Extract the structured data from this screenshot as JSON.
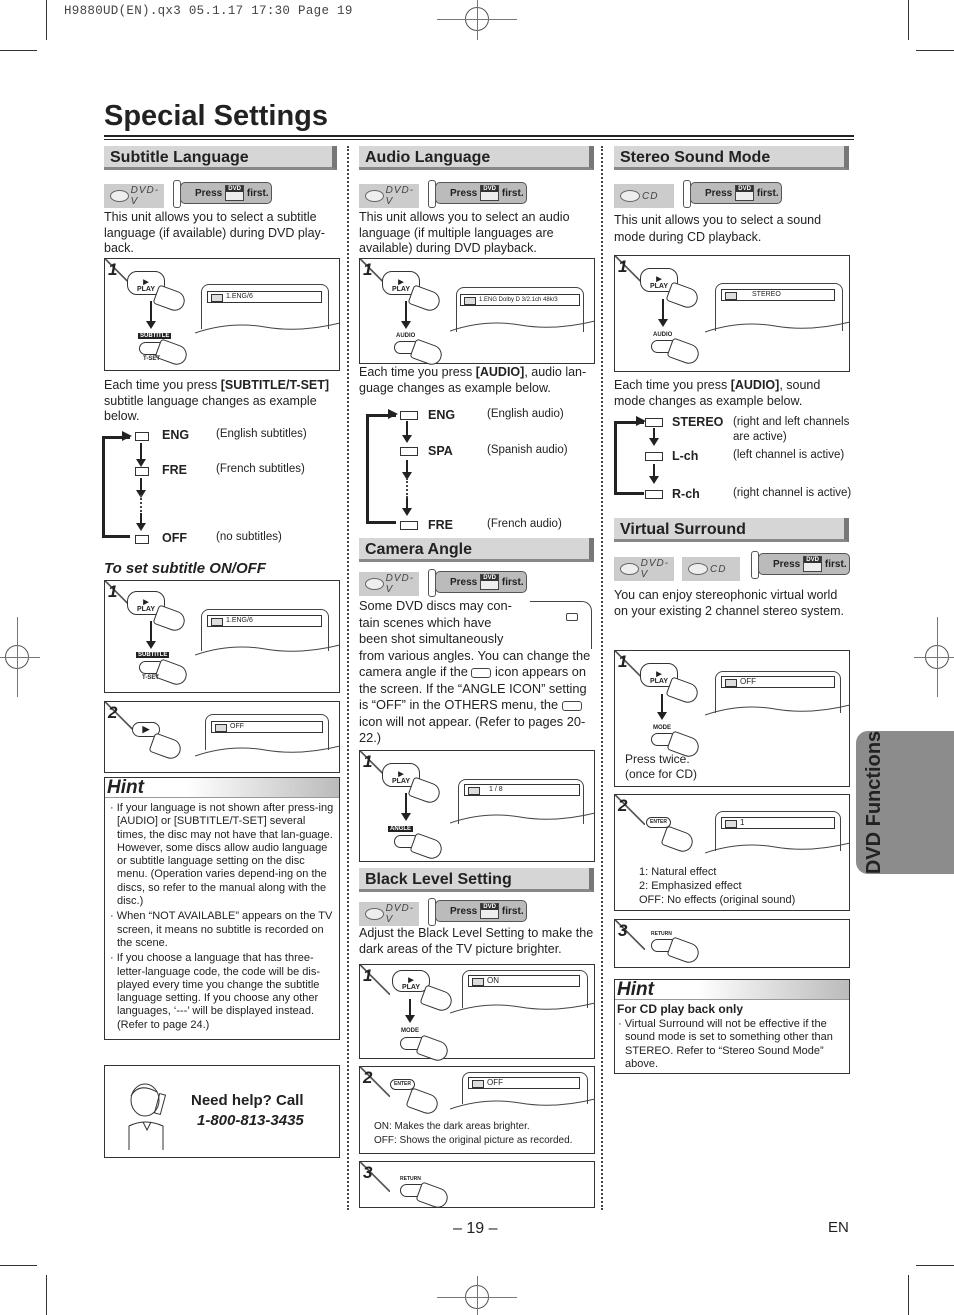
{
  "print_slug": "H9880UD(EN).qx3   05.1.17 17:30   Page 19",
  "page_title": "Special Settings",
  "side_tab": "DVD Functions",
  "page_number": "– 19 –",
  "language_code": "EN",
  "press_badge": {
    "press": "Press",
    "button": "DVD",
    "first": "first."
  },
  "disc_badges": {
    "dvd": "DVD-V",
    "cd": "CD"
  },
  "subtitle_language": {
    "heading": "Subtitle Language",
    "intro": "This unit allows you to select a subtitle language (if available) during DVD play-back.",
    "step1": {
      "no": "1",
      "play": "PLAY",
      "key_top": "SUBTITLE",
      "key_bottom": "T-SET",
      "osd": "1.ENG/6"
    },
    "each_time": "Each time you press [SUBTITLE/T-SET] subtitle language changes as example below.",
    "each_time_pre": "Each time you press ",
    "each_time_key": "[SUBTITLE/T-SET]",
    "each_time_post": " subtitle language changes as example below.",
    "cycle": [
      {
        "code": "ENG",
        "desc": "(English subtitles)"
      },
      {
        "code": "FRE",
        "desc": "(French subtitles)"
      },
      {
        "code": "OFF",
        "desc": "(no subtitles)"
      }
    ],
    "onoff_heading": "To set subtitle ON/OFF",
    "onoff_step1": {
      "no": "1",
      "play": "PLAY",
      "key_top": "SUBTITLE",
      "key_bottom": "T-SET",
      "osd": "1.ENG/6"
    },
    "onoff_step2": {
      "no": "2",
      "osd": "OFF"
    }
  },
  "hint_left": {
    "title": "Hint",
    "items": [
      "If your language is not shown after press-ing [AUDIO] or [SUBTITLE/T-SET] several times, the disc may not have that lan-guage. However, some discs allow audio language or subtitle language setting on the disc menu. (Operation varies depend-ing on the discs, so refer to the manual along with the disc.)",
      "When “NOT AVAILABLE” appears on the TV screen, it means no subtitle is recorded on the scene.",
      "If you choose a language that has three-letter-language code, the code will be dis-played every time you change the subtitle language setting. If you choose any other languages, ‘---’ will be displayed instead. (Refer to page 24.)"
    ]
  },
  "help": {
    "line1": "Need help? Call",
    "phone": "1-800-813-3435"
  },
  "audio_language": {
    "heading": "Audio Language",
    "intro": "This unit allows you to select an audio language (if multiple languages are available) during DVD playback.",
    "step1": {
      "no": "1",
      "play": "PLAY",
      "key": "AUDIO",
      "osd": "1.ENG  Dolby D  3/2.1ch  48k/3"
    },
    "each_time_pre": "Each time you press ",
    "each_time_key": "[AUDIO]",
    "each_time_post": ", audio lan-guage changes as example below.",
    "cycle": [
      {
        "code": "ENG",
        "desc": "(English audio)"
      },
      {
        "code": "SPA",
        "desc": "(Spanish audio)"
      },
      {
        "code": "FRE",
        "desc": "(French audio)"
      }
    ]
  },
  "camera_angle": {
    "heading": "Camera Angle",
    "intro": "Some DVD discs may con-tain scenes which have been shot simultaneously from various angles. You can change the camera angle if the [cam] icon appears on the screen. If the “ANGLE ICON” setting is “OFF” in the OTHERS menu, the [cam] icon will not appear. (Refer to pages 20-22.)",
    "step1": {
      "no": "1",
      "play": "PLAY",
      "key": "ANGLE",
      "osd": "1 / 8"
    }
  },
  "black_level": {
    "heading": "Black Level Setting",
    "intro": "Adjust the Black Level Setting to make the dark areas of the TV picture brighter.",
    "step1": {
      "no": "1",
      "play": "PLAY",
      "key": "MODE",
      "osd": "ON"
    },
    "step2": {
      "no": "2",
      "key": "ENTER",
      "osd": "OFF",
      "note1": "ON: Makes the dark areas brighter.",
      "note2": "OFF: Shows the original picture as recorded."
    },
    "step3": {
      "no": "3",
      "key": "RETURN"
    }
  },
  "stereo_sound": {
    "heading": "Stereo Sound Mode",
    "intro": "This unit allows you to select a sound mode during CD playback.",
    "step1": {
      "no": "1",
      "play": "PLAY",
      "key": "AUDIO",
      "osd": "STEREO"
    },
    "each_time_pre": "Each time you press ",
    "each_time_key": "[AUDIO]",
    "each_time_post": ", sound mode changes as example below.",
    "cycle": [
      {
        "code": "STEREO",
        "desc": "(right and left channels are active)"
      },
      {
        "code": "L-ch",
        "desc": "(left channel is active)"
      },
      {
        "code": "R-ch",
        "desc": "(right channel is active)"
      }
    ]
  },
  "virtual_surround": {
    "heading": "Virtual Surround",
    "intro": "You can enjoy stereophonic virtual world on your existing 2 channel stereo system.",
    "step1": {
      "no": "1",
      "play": "PLAY",
      "key": "MODE",
      "osd": "OFF",
      "note1": "Press twice.",
      "note2": "(once for CD)"
    },
    "step2": {
      "no": "2",
      "key": "ENTER",
      "osd": "1",
      "notes": [
        "1: Natural effect",
        "2: Emphasized effect",
        "OFF: No effects (original sound)"
      ]
    },
    "step3": {
      "no": "3",
      "key": "RETURN"
    }
  },
  "hint_right": {
    "title": "Hint",
    "subtitle": "For CD play back only",
    "items": [
      "Virtual Surround will not be effective if the sound mode is set to something other than STEREO. Refer to “Stereo Sound Mode” above."
    ]
  }
}
